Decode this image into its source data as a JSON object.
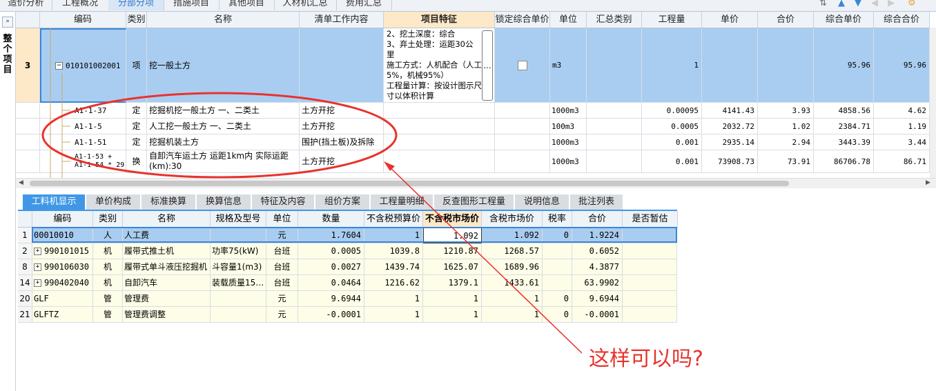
{
  "top_tabs": [
    "造价分析",
    "工程概况",
    "分部分项",
    "措施项目",
    "其他项目",
    "人材机汇总",
    "费用汇总"
  ],
  "left_panel": {
    "collapse_glyph": "»",
    "title": "整个项目"
  },
  "upper_headers": [
    "编码",
    "类别",
    "名称",
    "清单工作内容",
    "项目特征",
    "锁定综合单价",
    "单位",
    "汇总类别",
    "工程量",
    "单价",
    "合价",
    "综合单价",
    "综合合价"
  ],
  "main_item": {
    "row_num": "3",
    "code": "010101002001",
    "type": "项",
    "name": "挖一般土方",
    "features": [
      "2、挖土深度：综合",
      "3、弃土处理：运距30公里",
      "施工方式：人机配合（人工5%，机械95%）",
      "工程量计算：按设计图示尺寸以体积计算"
    ],
    "ellipsis": "...",
    "unit": "m3",
    "quantity": "1",
    "composite_price": "95.96",
    "composite_total": "95.96"
  },
  "sub_items": [
    {
      "code": "A1-1-37",
      "type": "定",
      "name": "挖掘机挖一般土方 一、二类土",
      "work": "土方开挖",
      "unit": "1000m3",
      "qty": "0.00095",
      "price": "4141.43",
      "total": "3.93",
      "cprice": "4858.56",
      "ctotal": "4.62"
    },
    {
      "code": "A1-1-5",
      "type": "定",
      "name": "人工挖一般土方 一、二类土",
      "work": "土方开挖",
      "unit": "100m3",
      "qty": "0.0005",
      "price": "2032.72",
      "total": "1.02",
      "cprice": "2384.71",
      "ctotal": "1.19"
    },
    {
      "code": "A1-1-51",
      "type": "定",
      "name": "挖掘机装土方",
      "work": "围护(挡土板)及拆除",
      "unit": "1000m3",
      "qty": "0.001",
      "price": "2935.14",
      "total": "2.94",
      "cprice": "3443.39",
      "ctotal": "3.44"
    },
    {
      "code": "A1-1-53 + A1-1-54 * 29",
      "type": "换",
      "name": "自卸汽车运土方 运距1km内 实际运距(km):30",
      "work": "土方开挖",
      "unit": "1000m3",
      "qty": "0.001",
      "price": "73908.73",
      "total": "73.91",
      "cprice": "86706.78",
      "ctotal": "86.71"
    }
  ],
  "bottom_tabs": [
    "工料机显示",
    "单价构成",
    "标准换算",
    "换算信息",
    "特征及内容",
    "组价方案",
    "工程量明细",
    "反查图形工程量",
    "说明信息",
    "批注列表"
  ],
  "bottom_headers": [
    "",
    "编码",
    "类别",
    "名称",
    "规格及型号",
    "单位",
    "数量",
    "不含税预算价",
    "不含税市场价",
    "含税市场价",
    "税率",
    "合价",
    "是否暂估"
  ],
  "bottom_rows": [
    {
      "n": "1",
      "code": "00010010",
      "expand": false,
      "cat": "人",
      "name": "人工费",
      "spec": "",
      "unit": "元",
      "qty": "1.7604",
      "pre": "1",
      "mkt": "1.092",
      "tax_mkt": "1.092",
      "rate": "0",
      "total": "1.9224"
    },
    {
      "n": "2",
      "code": "990101015",
      "expand": true,
      "cat": "机",
      "name": "履带式推土机",
      "spec": "功率75(kW)",
      "unit": "台班",
      "qty": "0.0005",
      "pre": "1039.8",
      "mkt": "1210.87",
      "tax_mkt": "1268.57",
      "rate": "",
      "total": "0.6052"
    },
    {
      "n": "8",
      "code": "990106030",
      "expand": true,
      "cat": "机",
      "name": "履带式单斗液压挖掘机",
      "spec": "斗容量1(m3)",
      "unit": "台班",
      "qty": "0.0027",
      "pre": "1439.74",
      "mkt": "1625.07",
      "tax_mkt": "1689.96",
      "rate": "",
      "total": "4.3877"
    },
    {
      "n": "14",
      "code": "990402040",
      "expand": true,
      "cat": "机",
      "name": "自卸汽车",
      "spec": "装载质量15…",
      "unit": "台班",
      "qty": "0.0464",
      "pre": "1216.62",
      "mkt": "1379.1",
      "tax_mkt": "1433.61",
      "rate": "",
      "total": "63.9902"
    },
    {
      "n": "20",
      "code": "GLF",
      "expand": false,
      "cat": "管",
      "name": "管理费",
      "spec": "",
      "unit": "元",
      "qty": "9.6944",
      "pre": "1",
      "mkt": "1",
      "tax_mkt": "1",
      "rate": "0",
      "total": "9.6944"
    },
    {
      "n": "21",
      "code": "GLFTZ",
      "expand": false,
      "cat": "管",
      "name": "管理费调整",
      "spec": "",
      "unit": "元",
      "qty": "-0.0001",
      "pre": "1",
      "mkt": "1",
      "tax_mkt": "1",
      "rate": "0",
      "total": "-0.0001"
    }
  ],
  "annotation": {
    "text": "这样可以吗?",
    "color": "#e8322d"
  },
  "colors": {
    "selected_row": "#a9cdf0",
    "highlight_header": "#fde8c8",
    "tab_active": "#3f97e6",
    "machine_row": "#fefde8"
  }
}
